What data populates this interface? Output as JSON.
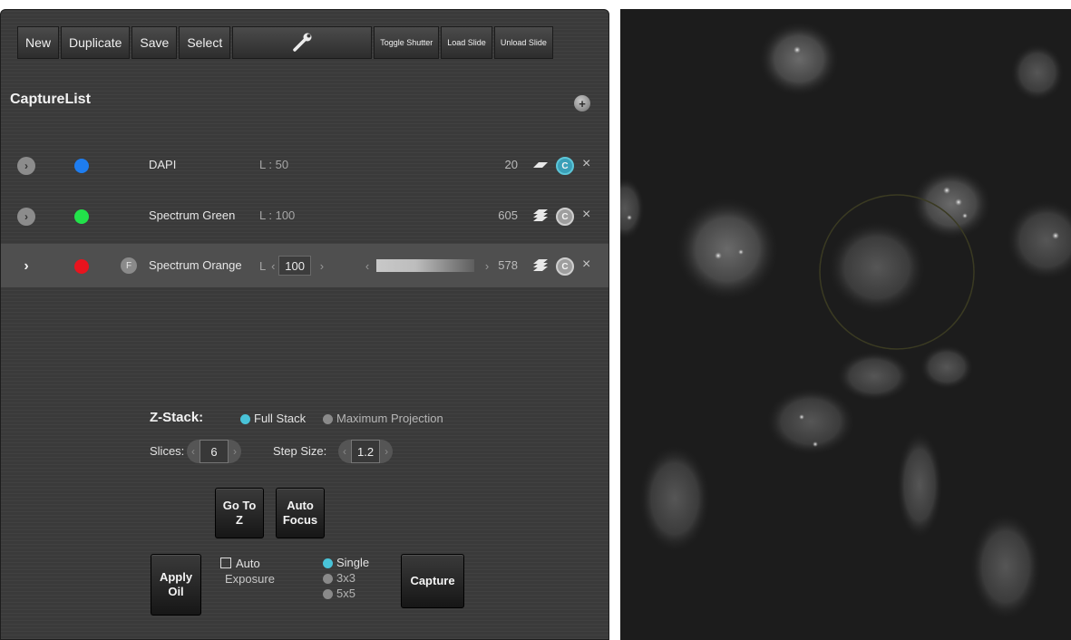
{
  "toolbar": {
    "new": "New",
    "duplicate": "Duplicate",
    "save": "Save",
    "select": "Select",
    "settings_icon": "wrench-icon",
    "toggle_shutter": "Toggle Shutter",
    "load_slide": "Load Slide",
    "unload_slide": "Unload Slide"
  },
  "capture_list": {
    "title": "CaptureList",
    "add_icon": "plus-icon",
    "rows": [
      {
        "name": "DAPI",
        "level": "L : 50",
        "value": "20",
        "color": "#1e7df0",
        "c_label": "C",
        "c_active": true
      },
      {
        "name": "Spectrum Green",
        "level": "L : 100",
        "value": "605",
        "color": "#22e24a",
        "c_label": "C",
        "c_active": false
      },
      {
        "name": "Spectrum Orange",
        "level_prefix": "L",
        "level_value": "100",
        "value": "578",
        "color": "#e8141e",
        "f_label": "F",
        "c_label": "C",
        "c_active": false
      }
    ],
    "close_glyph": "×"
  },
  "zstack": {
    "label": "Z-Stack:",
    "full_stack": "Full Stack",
    "max_projection": "Maximum Projection",
    "slices_label": "Slices:",
    "slices_value": "6",
    "step_label": "Step Size:",
    "step_value": "1.2"
  },
  "actions": {
    "go_to_z_line1": "Go To",
    "go_to_z_line2": "Z",
    "auto_focus_line1": "Auto",
    "auto_focus_line2": "Focus",
    "apply_oil_line1": "Apply",
    "apply_oil_line2": "Oil",
    "auto_exposure_line1": "Auto",
    "auto_exposure_line2": "Exposure",
    "single": "Single",
    "grid3": "3x3",
    "grid5": "5x5",
    "capture": "Capture"
  }
}
